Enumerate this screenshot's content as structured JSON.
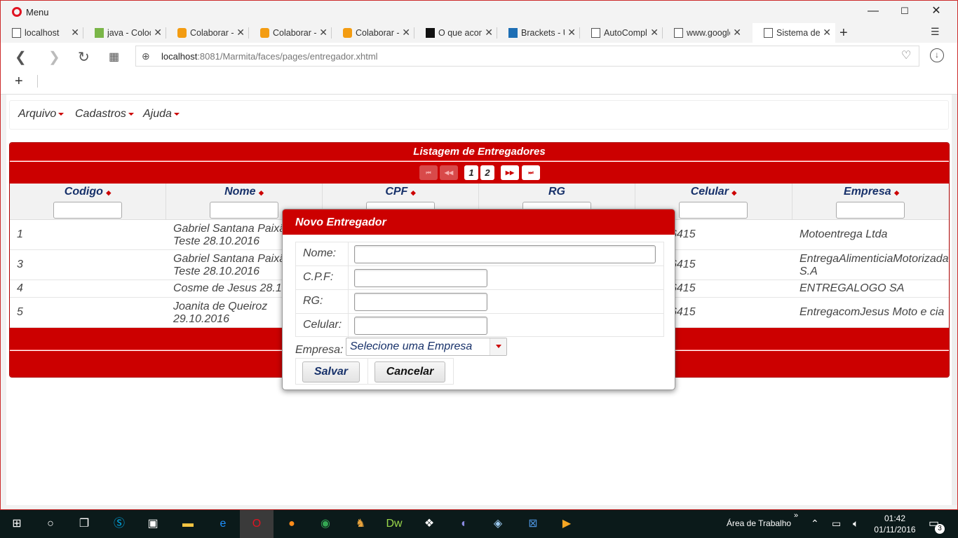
{
  "window": {
    "menu_label": "Menu",
    "controls": [
      "—",
      "☐",
      "✕"
    ]
  },
  "tabs": [
    {
      "label": "localhost",
      "icon": "page-icon"
    },
    {
      "label": "java - Colocar",
      "icon": "stackoverflow-icon"
    },
    {
      "label": "Colaborar - ",
      "icon": "colaborar-icon"
    },
    {
      "label": "Colaborar - ",
      "icon": "colaborar-icon"
    },
    {
      "label": "Colaborar - ",
      "icon": "colaborar-icon"
    },
    {
      "label": "O que acontece",
      "icon": "jetbrains-icon"
    },
    {
      "label": "Brackets - U",
      "icon": "brackets-icon"
    },
    {
      "label": "AutoComplete",
      "icon": "page-icon"
    },
    {
      "label": "www.google.",
      "icon": "page-icon"
    },
    {
      "label": "Sistema de M",
      "icon": "page-icon",
      "active": true
    }
  ],
  "address": {
    "host": "localhost",
    "rest": ":8081/Marmita/faces/pages/entregador.xhtml"
  },
  "menu": {
    "items": [
      "Arquivo",
      "Cadastros",
      "Ajuda"
    ]
  },
  "table": {
    "caption": "Listagem de Entregadores",
    "pages": [
      "1",
      "2"
    ],
    "nav_first": "⏮",
    "nav_prev": "◀◀",
    "nav_next": "▶▶",
    "nav_last": "⏭",
    "columns": [
      "Codigo",
      "Nome",
      "CPF",
      "RG",
      "Celular",
      "Empresa"
    ],
    "sortable": [
      true,
      true,
      true,
      false,
      true,
      true
    ],
    "rows": [
      {
        "codigo": "1",
        "nome": "Gabriel Santana Paixão Teste 28.10.2016",
        "celular": "6415",
        "empresa": "Motoentrega Ltda"
      },
      {
        "codigo": "3",
        "nome": "Gabriel Santana Paixão Teste 28.10.2016",
        "celular": "6415",
        "empresa": "EntregaAlimenticiaMotorizada S.A"
      },
      {
        "codigo": "4",
        "nome": "Cosme de Jesus 28.10.2016",
        "celular": "6415",
        "empresa": "ENTREGALOGO SA"
      },
      {
        "codigo": "5",
        "nome": "Joanita de Queiroz 29.10.2016",
        "celular": "6415",
        "empresa": "EntregacomJesus Moto e cia"
      }
    ]
  },
  "dialog": {
    "title": "Novo Entregador",
    "labels": {
      "nome": "Nome:",
      "cpf": "C.P.F:",
      "rg": "RG:",
      "celular": "Celular:",
      "empresa": "Empresa:"
    },
    "values": {
      "nome": "",
      "cpf": "",
      "rg": "",
      "celular": ""
    },
    "empresa_selected": "Selecione uma Empresa",
    "save": "Salvar",
    "cancel": "Cancelar"
  },
  "taskbar": {
    "desktop_label": "Área de Trabalho",
    "time": "01:42",
    "date": "01/11/2016",
    "notifications": "3"
  },
  "colors": {
    "accent": "#cc0000",
    "header_text": "#17316a"
  }
}
